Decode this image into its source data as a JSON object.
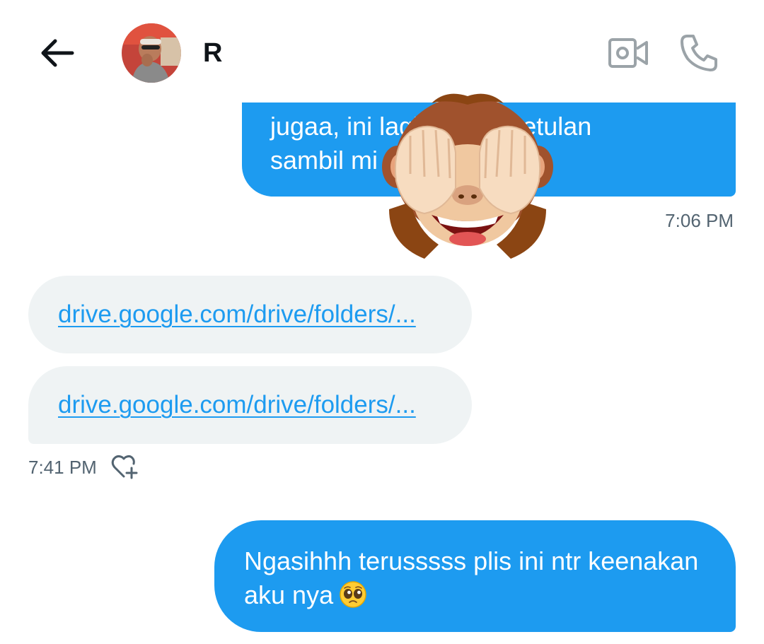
{
  "header": {
    "contact_name": "R",
    "icons": {
      "back": "arrow-left-icon",
      "video": "video-camera-icon",
      "call": "phone-icon"
    }
  },
  "messages": [
    {
      "direction": "outgoing",
      "text": "jugaa, ini lagi ... ih kebetulan\nsambil mi ... gituu",
      "timestamp": "7:06 PM"
    },
    {
      "direction": "incoming",
      "links": [
        "drive.google.com/drive/folders/...",
        "drive.google.com/drive/folders/..."
      ],
      "timestamp": "7:41 PM",
      "reaction_icon": "heart-plus-icon"
    },
    {
      "direction": "outgoing",
      "text_line1": "Ngasihhh terusssss plis ini ntr keenakan",
      "text_line2": "aku nya",
      "emoji": "pleading-face-emoji"
    }
  ],
  "sticker": "see-no-evil-monkey-sticker",
  "colors": {
    "accent": "#1d9bf0",
    "incoming_bubble": "#eff3f4",
    "muted_text": "#536471",
    "icon_gray": "#9ba3a8"
  }
}
